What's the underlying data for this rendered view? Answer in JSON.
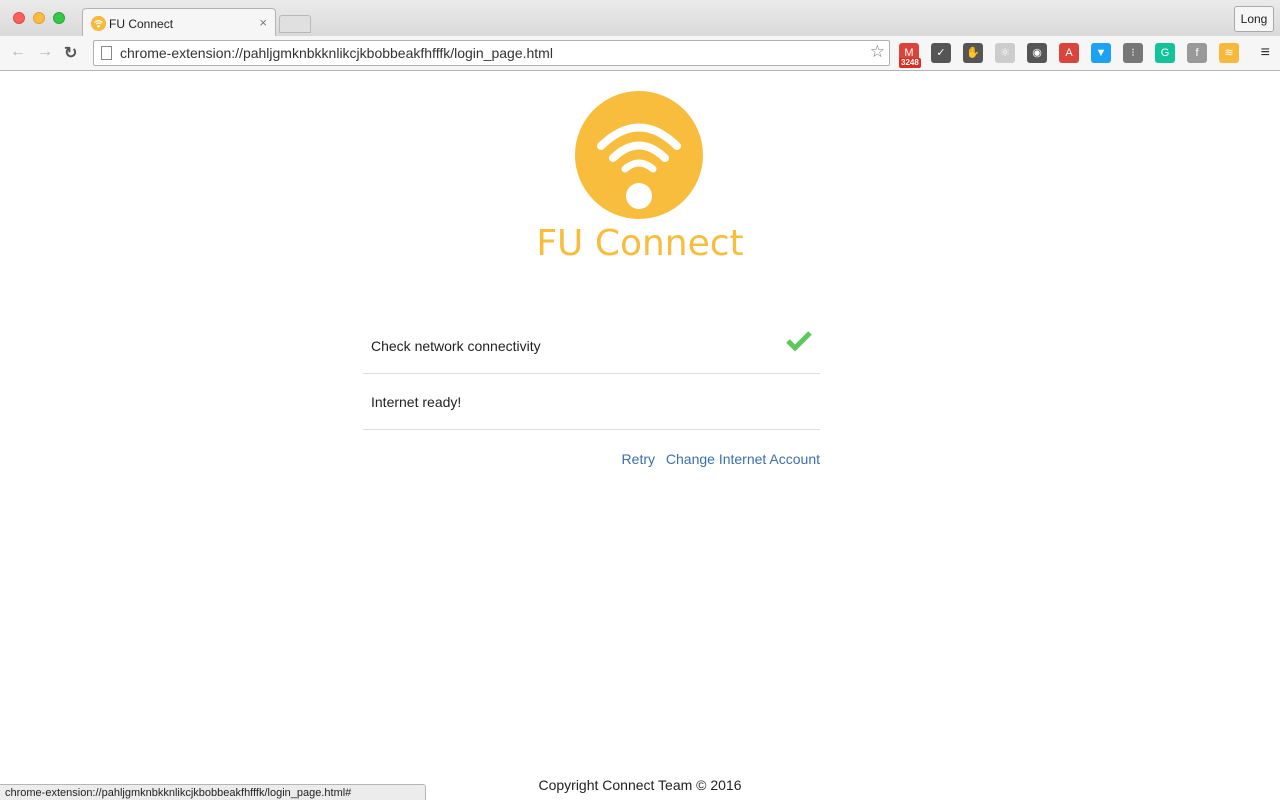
{
  "browser": {
    "tab": {
      "title": "FU Connect",
      "favicon": "wifi-icon",
      "close": "×"
    },
    "profile_button": "Long",
    "nav": {
      "back": "←",
      "forward": "→",
      "reload": "↻"
    },
    "address": "chrome-extension://pahljgmknbkknlikcjkbobbeakfhfffk/login_page.html",
    "bookmark_icon": "☆",
    "extensions": [
      {
        "name": "gmail",
        "glyph": "M",
        "badge": "3248",
        "color": "#d9453a"
      },
      {
        "name": "pocket",
        "glyph": "✓",
        "color": "#555555"
      },
      {
        "name": "hand",
        "glyph": "✋",
        "color": "#555555"
      },
      {
        "name": "react",
        "glyph": "⚛",
        "color": "#cccccc"
      },
      {
        "name": "glasses",
        "glyph": "◉",
        "color": "#555555"
      },
      {
        "name": "book",
        "glyph": "A",
        "color": "#d9453a"
      },
      {
        "name": "diamond",
        "glyph": "▼",
        "color": "#1da1f2"
      },
      {
        "name": "plug",
        "glyph": "⁝",
        "color": "#777777"
      },
      {
        "name": "grammarly",
        "glyph": "G",
        "color": "#15c39a"
      },
      {
        "name": "fb-image",
        "glyph": "f",
        "color": "#999999"
      },
      {
        "name": "fu-connect",
        "glyph": "≋",
        "color": "#f6b93b"
      }
    ],
    "menu_icon": "≡",
    "status_url": "chrome-extension://pahljgmknbkknlikcjkbobbeakfhfffk/login_page.html#"
  },
  "page": {
    "brand": "FU Connect",
    "brand_color": "#f8bd3d",
    "checks": [
      {
        "label": "Check network connectivity",
        "status": "success"
      },
      {
        "label": "Internet ready!",
        "status": ""
      }
    ],
    "success_color": "#5cc75a",
    "actions": {
      "retry": "Retry",
      "change_account": "Change Internet Account"
    },
    "footer": "Copyright Connect Team © 2016"
  }
}
